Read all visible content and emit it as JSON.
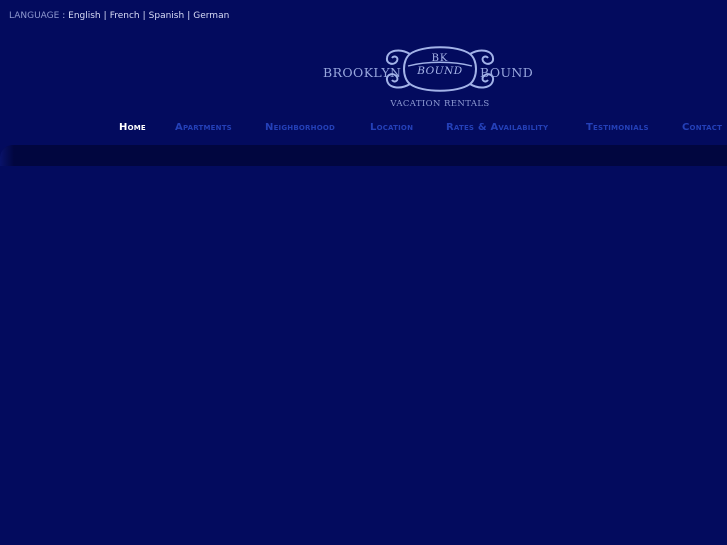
{
  "language_bar": {
    "label": "LANGUAGE",
    "colon": ":",
    "separator": "|",
    "languages": [
      "English",
      "French",
      "Spanish",
      "German"
    ]
  },
  "logo": {
    "left_word": "BROOKLYN",
    "right_word": "BOUND",
    "emblem_top": "BK",
    "emblem_bottom": "BOUND",
    "tagline": "VACATION RENTALS"
  },
  "nav": {
    "items": [
      {
        "label": "Home",
        "active": true
      },
      {
        "label": "Apartments",
        "active": false
      },
      {
        "label": "Neighborhood",
        "active": false
      },
      {
        "label": "Location",
        "active": false
      },
      {
        "label": "Rates & Availability",
        "active": false
      },
      {
        "label": "Testimonials",
        "active": false
      },
      {
        "label": "Contact",
        "active": false
      }
    ]
  },
  "colors": {
    "background": "#030b5e",
    "band": "#01063f",
    "nav_inactive": "#2440b8",
    "nav_active": "#ffffff",
    "logo_text": "#98a7de"
  }
}
